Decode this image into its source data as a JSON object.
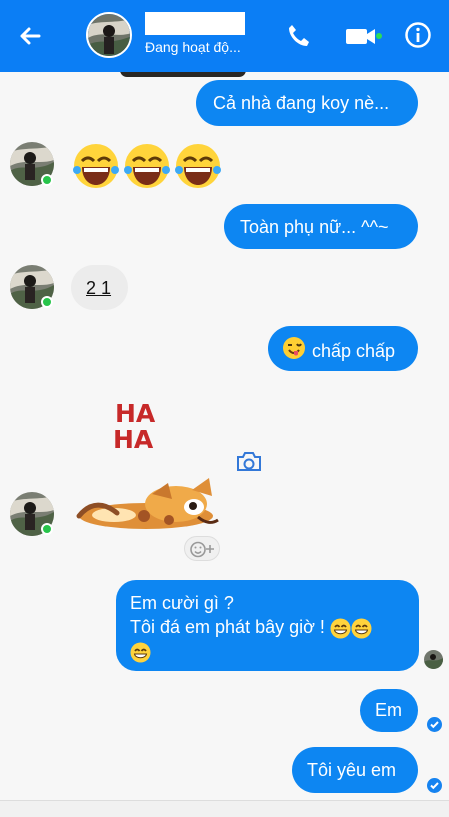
{
  "header": {
    "status": "Đang hoạt độ...",
    "back_icon": "back-arrow-icon",
    "call_icon": "phone-icon",
    "video_icon": "video-camera-icon",
    "info_icon": "info-icon",
    "accent_color": "#0b7ef5"
  },
  "messages": [
    {
      "side": "outgoing",
      "text": "Cả nhà đang koy nè..."
    },
    {
      "side": "incoming",
      "emojis": [
        "grinning-tears-emoji",
        "grinning-tears-emoji",
        "grinning-tears-emoji"
      ]
    },
    {
      "side": "outgoing",
      "text": "Toàn phụ nữ... ^^~"
    },
    {
      "side": "incoming",
      "text": "2 1"
    },
    {
      "side": "outgoing",
      "text": "chấp chấp",
      "emoji": "winking-tongue-emoji"
    },
    {
      "side": "incoming",
      "sticker_text": "HA HA",
      "sticker": "laughing-dog-sticker"
    },
    {
      "side": "outgoing",
      "lines": [
        "Em cười gì ?",
        "Tôi đá em phát bây giờ !"
      ],
      "emoji": "grinning-emoji"
    },
    {
      "side": "outgoing",
      "text": "Em"
    },
    {
      "side": "outgoing",
      "text": "Tôi yêu em"
    }
  ]
}
